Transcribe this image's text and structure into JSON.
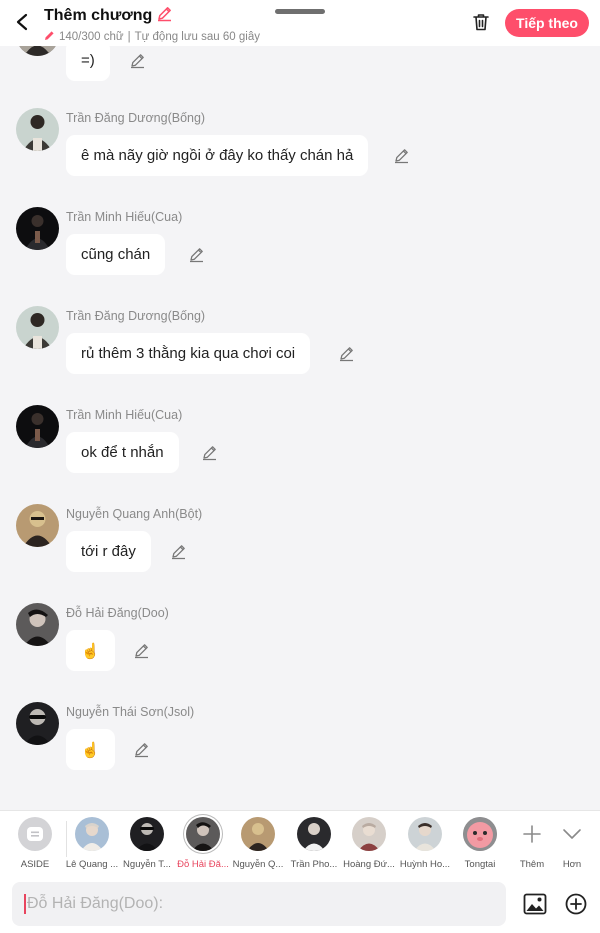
{
  "header": {
    "title": "Thêm chương",
    "word_count": "140/300 chữ",
    "autosave": "Tự động lưu sau 60 giây",
    "next_label": "Tiếp theo",
    "accent": "#fe4e6b"
  },
  "messages": [
    {
      "sender": "",
      "text": "=)"
    },
    {
      "sender": "Trần Đăng Dương(Bống)",
      "text": "ê mà nãy giờ ngồi ở đây ko thấy chán hả"
    },
    {
      "sender": "Trần Minh Hiếu(Cua)",
      "text": "cũng chán"
    },
    {
      "sender": "Trần Đăng Dương(Bống)",
      "text": "rủ thêm 3 thằng kia qua chơi coi"
    },
    {
      "sender": "Trần Minh Hiếu(Cua)",
      "text": "ok để t nhắn"
    },
    {
      "sender": "Nguyễn Quang Anh(Bột)",
      "text": "tới r đây"
    },
    {
      "sender": "Đỗ Hải Đăng(Doo)",
      "text": "☝"
    },
    {
      "sender": "Nguyễn Thái Sơn(Jsol)",
      "text": "☝"
    }
  ],
  "characters": [
    {
      "label": "ASIDE"
    },
    {
      "label": "Lê Quang ..."
    },
    {
      "label": "Nguyễn T..."
    },
    {
      "label": "Đỗ Hải Đă..."
    },
    {
      "label": "Nguyễn Q..."
    },
    {
      "label": "Trần Pho..."
    },
    {
      "label": "Hoàng Đứ..."
    },
    {
      "label": "Huỳnh Ho..."
    },
    {
      "label": "Tongtai"
    }
  ],
  "tools": {
    "more_label": "Thêm",
    "expand_label": "Hơn"
  },
  "input": {
    "placeholder": "Đỗ Hải Đăng(Doo):"
  }
}
